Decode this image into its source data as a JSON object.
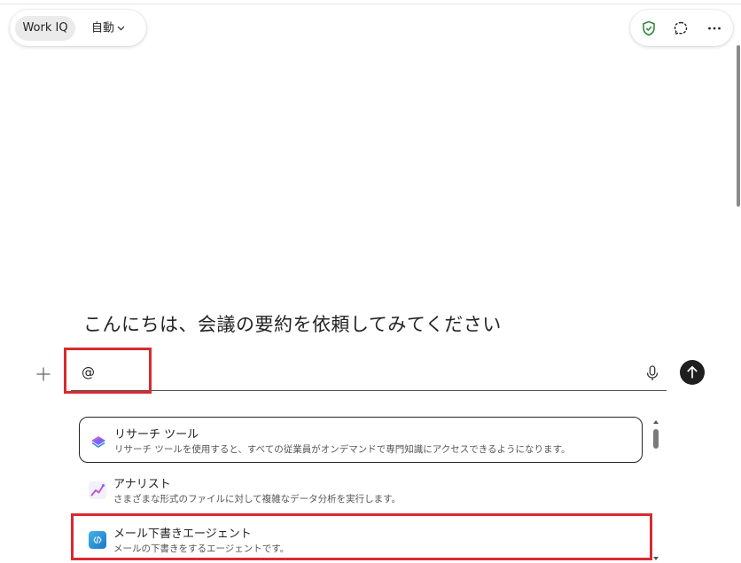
{
  "header": {
    "mode_button": "Work IQ",
    "auto_dropdown": "自動",
    "icons": [
      "shield-check-icon",
      "chat-bubble-icon",
      "more-icon"
    ],
    "shield_color": "#2e8b3d"
  },
  "greeting": "こんにちは、会議の要約を依頼してみてください",
  "composer": {
    "value": "@",
    "icons": [
      "plus-icon",
      "microphone-icon",
      "send-arrow-icon"
    ]
  },
  "suggestions": [
    {
      "title": "リサーチ ツール",
      "description": "リサーチ ツールを使用すると、すべての従業員がオンデマンドで専門知識にアクセスできるようになります。",
      "icon": "researcher-icon"
    },
    {
      "title": "アナリスト",
      "description": "さまざまな形式のファイルに対して複雑なデータ分析を実行します。",
      "icon": "analyst-icon"
    },
    {
      "title": "メール下書きエージェント",
      "description": "メールの下書きをするエージェントです。",
      "icon": "email-agent-icon"
    }
  ],
  "highlight_color": "#d92a2f"
}
